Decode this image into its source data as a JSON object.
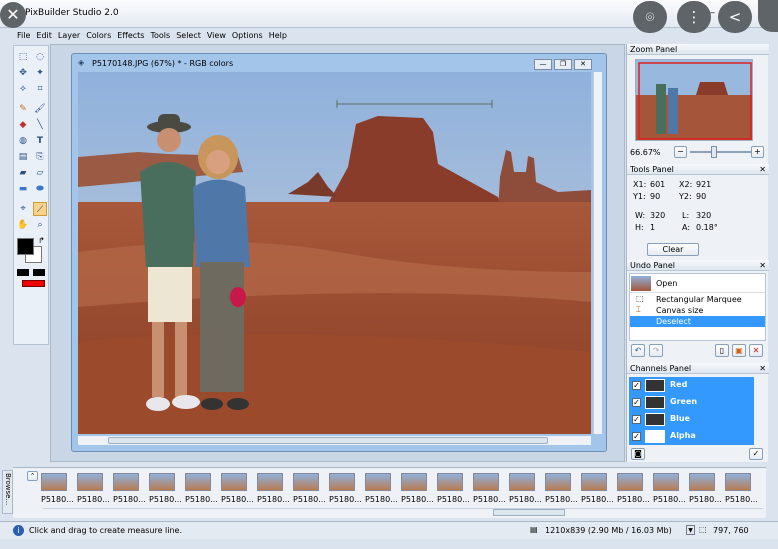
{
  "app": {
    "title": "PixBuilder Studio 2.0"
  },
  "menu": [
    "File",
    "Edit",
    "Layer",
    "Colors",
    "Effects",
    "Tools",
    "Select",
    "View",
    "Options",
    "Help"
  ],
  "document": {
    "title": "P5170148.JPG (67%) * - RGB colors"
  },
  "zoom_panel": {
    "title": "Zoom Panel",
    "zoom_value": "66.67%"
  },
  "tools_panel": {
    "title": "Tools Panel",
    "x1": "X1:",
    "x1_val": "601",
    "x2": "X2:",
    "x2_val": "921",
    "y1": "Y1:",
    "y1_val": "90",
    "y2": "Y2:",
    "y2_val": "90",
    "w": "W:",
    "w_val": "320",
    "l": "L:",
    "l_val": "320",
    "h": "H:",
    "h_val": "1",
    "a": "A:",
    "a_val": "0.18°",
    "clear_label": "Clear"
  },
  "undo_panel": {
    "title": "Undo Panel",
    "items": [
      "Open",
      "Rectangular Marquee",
      "Canvas size",
      "Deselect"
    ]
  },
  "channels_panel": {
    "title": "Channels Panel",
    "channels": [
      "Red",
      "Green",
      "Blue",
      "Alpha"
    ]
  },
  "browser_tab": "Browse...",
  "filmstrip": {
    "label": "P5180..."
  },
  "status": {
    "hint": "Click and drag to create measure line.",
    "image_info": "1210x839  (2.90 Mb / 16.03 Mb)",
    "coords": "797, 760"
  }
}
